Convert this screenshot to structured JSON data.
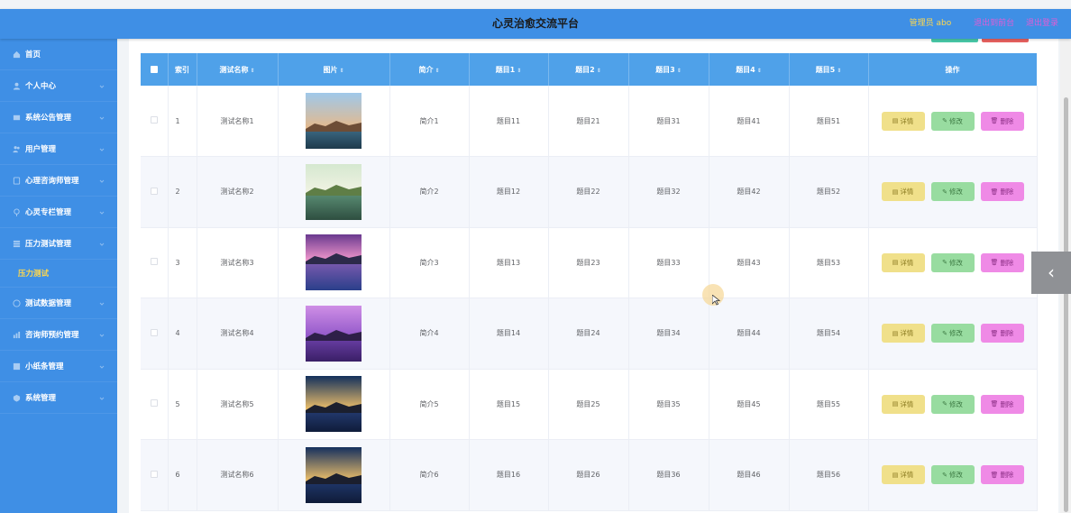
{
  "header": {
    "title": "心灵治愈交流平台",
    "admin": "管理员 abo",
    "links": [
      "退出到前台",
      "退出登录"
    ]
  },
  "sidebar": {
    "items": [
      {
        "label": "首页",
        "icon": "home-icon",
        "chevron": false
      },
      {
        "label": "个人中心",
        "icon": "user-icon",
        "chevron": true
      },
      {
        "label": "系统公告管理",
        "icon": "notice-icon",
        "chevron": true
      },
      {
        "label": "用户管理",
        "icon": "users-icon",
        "chevron": true
      },
      {
        "label": "心理咨询师管理",
        "icon": "counselor-icon",
        "chevron": true
      },
      {
        "label": "心灵专栏管理",
        "icon": "column-icon",
        "chevron": true
      },
      {
        "label": "压力测试管理",
        "icon": "test-icon",
        "chevron": true
      },
      {
        "label": "测试数据管理",
        "icon": "data-icon",
        "chevron": true
      },
      {
        "label": "咨询师预约管理",
        "icon": "appointment-icon",
        "chevron": true
      },
      {
        "label": "小纸条管理",
        "icon": "note-icon",
        "chevron": true
      },
      {
        "label": "系统管理",
        "icon": "settings-icon",
        "chevron": true
      }
    ],
    "active_sub": "压力测试"
  },
  "table": {
    "columns": [
      "索引",
      "测试名称",
      "图片",
      "简介",
      "题目1",
      "题目2",
      "题目3",
      "题目4",
      "题目5",
      "操作"
    ],
    "rows": [
      {
        "index": "1",
        "name": "测试名称1",
        "intro": "简介1",
        "q1": "题目11",
        "q2": "题目21",
        "q3": "题目31",
        "q4": "题目41",
        "q5": "题目51"
      },
      {
        "index": "2",
        "name": "测试名称2",
        "intro": "简介2",
        "q1": "题目12",
        "q2": "题目22",
        "q3": "题目32",
        "q4": "题目42",
        "q5": "题目52"
      },
      {
        "index": "3",
        "name": "测试名称3",
        "intro": "简介3",
        "q1": "题目13",
        "q2": "题目23",
        "q3": "题目33",
        "q4": "题目43",
        "q5": "题目53"
      },
      {
        "index": "4",
        "name": "测试名称4",
        "intro": "简介4",
        "q1": "题目14",
        "q2": "题目24",
        "q3": "题目34",
        "q4": "题目44",
        "q5": "题目54"
      },
      {
        "index": "5",
        "name": "测试名称5",
        "intro": "简介5",
        "q1": "题目15",
        "q2": "题目25",
        "q3": "题目35",
        "q4": "题目45",
        "q5": "题目55"
      },
      {
        "index": "6",
        "name": "测试名称6",
        "intro": "简介6",
        "q1": "题目16",
        "q2": "题目26",
        "q3": "题目36",
        "q4": "题目46",
        "q5": "题目56"
      }
    ],
    "actions": {
      "detail": "详情",
      "edit": "修改",
      "delete": "删除"
    }
  },
  "colors": {
    "primary": "#3f8fe5",
    "table_header": "#4fa1e9",
    "active_text": "#ffd84d",
    "detail_btn": "#f0e08a",
    "edit_btn": "#98dca0",
    "delete_btn": "#ef8ae6"
  }
}
